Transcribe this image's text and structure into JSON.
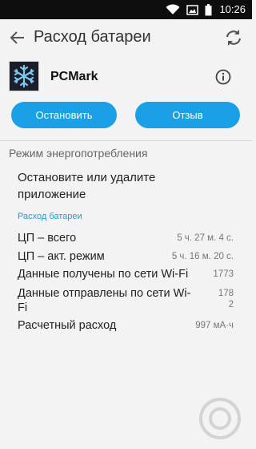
{
  "status_bar": {
    "time": "10:26",
    "icons": [
      "wifi-icon",
      "image-icon",
      "battery-icon"
    ]
  },
  "app_bar": {
    "title": "Расход батареи",
    "back_icon": "arrow-back-icon",
    "refresh_icon": "refresh-icon"
  },
  "app": {
    "name": "PCMark",
    "icon": "snowflake-icon",
    "info_icon": "info-icon"
  },
  "actions": {
    "stop_label": "Остановить",
    "feedback_label": "Отзыв"
  },
  "power_mode": {
    "title": "Режим энергопотребления",
    "advice": "Остановите или удалите приложение"
  },
  "battery_usage": {
    "title": "Расход батареи",
    "rows": [
      {
        "label": "ЦП – всего",
        "value": "5 ч. 27 м. 4 с."
      },
      {
        "label": "ЦП – акт. режим",
        "value": "5 ч. 16 м. 20 с."
      },
      {
        "label": "Данные получены по сети Wi-Fi",
        "value": "1773"
      },
      {
        "label": "Данные отправлены по сети Wi-Fi",
        "value": "178\n2"
      },
      {
        "label": "Расчетный расход",
        "value": "997 мА·ч"
      }
    ]
  },
  "colors": {
    "accent": "#1aa0e5",
    "status_bar": "#0e0e0e",
    "background": "#f3f3f3"
  }
}
